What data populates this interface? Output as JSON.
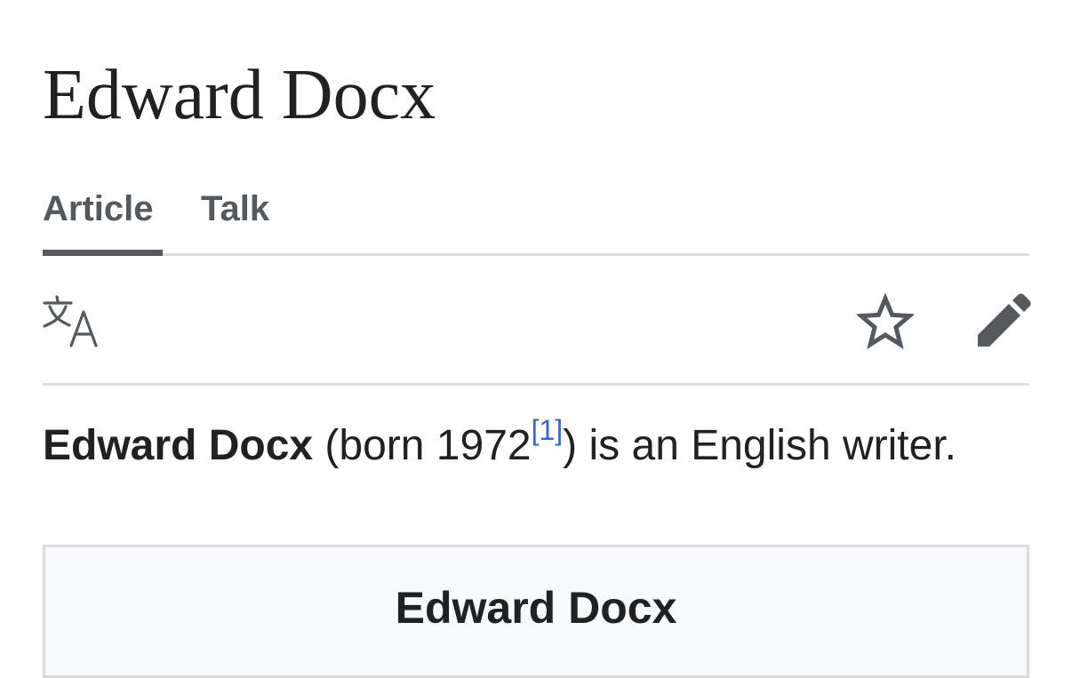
{
  "page": {
    "title": "Edward Docx"
  },
  "tabs": [
    {
      "label": "Article",
      "selected": true
    },
    {
      "label": "Talk",
      "selected": false
    }
  ],
  "toolbar": {
    "language_icon": "translate-icon",
    "watch_icon": "star-icon",
    "edit_icon": "pencil-icon"
  },
  "lead": {
    "subject": "Edward Docx",
    "before_citation": " (born 1972",
    "citation": "[1]",
    "after_citation": ") is an English writer."
  },
  "infobox": {
    "title": "Edward Docx"
  },
  "colors": {
    "text": "#202122",
    "muted": "#54595d",
    "link": "#3366cc",
    "divider": "#dcdcdc",
    "infobox_bg": "#f8f9fa"
  }
}
